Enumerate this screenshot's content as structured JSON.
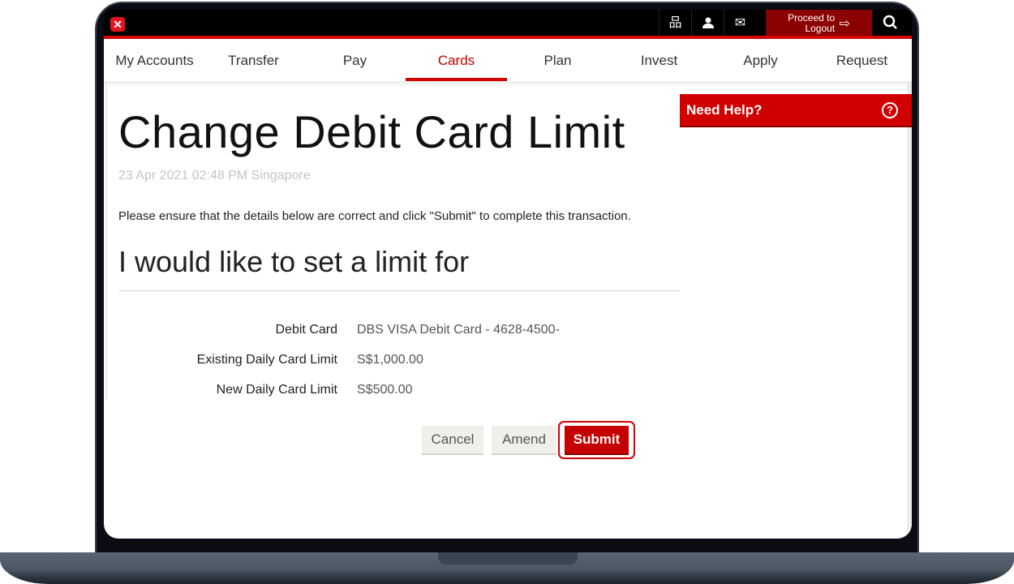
{
  "topbar": {
    "logo": "✕",
    "icons": [
      {
        "name": "sitemap-icon",
        "glyph": "品"
      },
      {
        "name": "profile-icon",
        "glyph": "👤"
      },
      {
        "name": "mail-icon",
        "glyph": "✉"
      }
    ],
    "logout_line1": "Proceed to",
    "logout_line2": "Logout",
    "logout_glyph": "⇨",
    "search_glyph": "Q"
  },
  "nav": {
    "items": [
      {
        "label": "My Accounts",
        "active": false
      },
      {
        "label": "Transfer",
        "active": false
      },
      {
        "label": "Pay",
        "active": false
      },
      {
        "label": "Cards",
        "active": true
      },
      {
        "label": "Plan",
        "active": false
      },
      {
        "label": "Invest",
        "active": false
      },
      {
        "label": "Apply",
        "active": false
      },
      {
        "label": "Request",
        "active": false
      }
    ]
  },
  "page": {
    "title": "Change Debit Card Limit",
    "timestamp": "23 Apr 2021 02:48 PM Singapore",
    "instruction": "Please ensure that the details below are correct and click \"Submit\" to complete this transaction.",
    "section_title": "I would like to set a limit for",
    "details": [
      {
        "label": "Debit Card",
        "value": "DBS VISA Debit Card - 4628-4500-"
      },
      {
        "label": "Existing Daily Card Limit",
        "value": "S$1,000.00"
      },
      {
        "label": "New Daily Card Limit",
        "value": "S$500.00"
      }
    ],
    "buttons": {
      "cancel": "Cancel",
      "amend": "Amend",
      "submit": "Submit"
    }
  },
  "help": {
    "label": "Need Help?",
    "icon_glyph": "?"
  },
  "colors": {
    "brand_red": "#d40000",
    "dark_red": "#8b0000",
    "topbar_bg": "#000000"
  }
}
